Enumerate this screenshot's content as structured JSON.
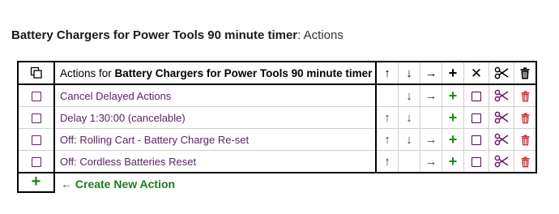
{
  "page": {
    "title_bold": "Battery Chargers for Power Tools 90 minute timer",
    "title_rest": ": Actions"
  },
  "table": {
    "header_prefix": "Actions for ",
    "header_bold": "Battery Chargers for Power Tools 90 minute timer",
    "header_icons": {
      "copy": "copy-icon",
      "up": "↑",
      "down": "↓",
      "right": "→",
      "plus": "+",
      "delete_x": "✕",
      "cut": "scissors-icon",
      "trash": "trash-icon"
    },
    "rows": [
      {
        "label": "Cancel Delayed Actions",
        "up": "",
        "down": "↓",
        "right": "→",
        "plus": "+"
      },
      {
        "label": "Delay 1:30:00 (cancelable)",
        "up": "↑",
        "down": "↓",
        "right": "",
        "plus": "+"
      },
      {
        "label": "Off: Rolling Cart - Battery Charge Re-set",
        "up": "↑",
        "down": "↓",
        "right": "→",
        "plus": "+"
      },
      {
        "label": "Off: Cordless Batteries Reset",
        "up": "↑",
        "down": "",
        "right": "→",
        "plus": "+"
      }
    ]
  },
  "footer": {
    "add_symbol": "+",
    "create_arrow": "←",
    "create_label": "Create New Action"
  },
  "colors": {
    "link": "#5b2368",
    "green": "#1b8a1b",
    "red": "#d32f2f",
    "purple_icon": "#6b1a6f"
  }
}
